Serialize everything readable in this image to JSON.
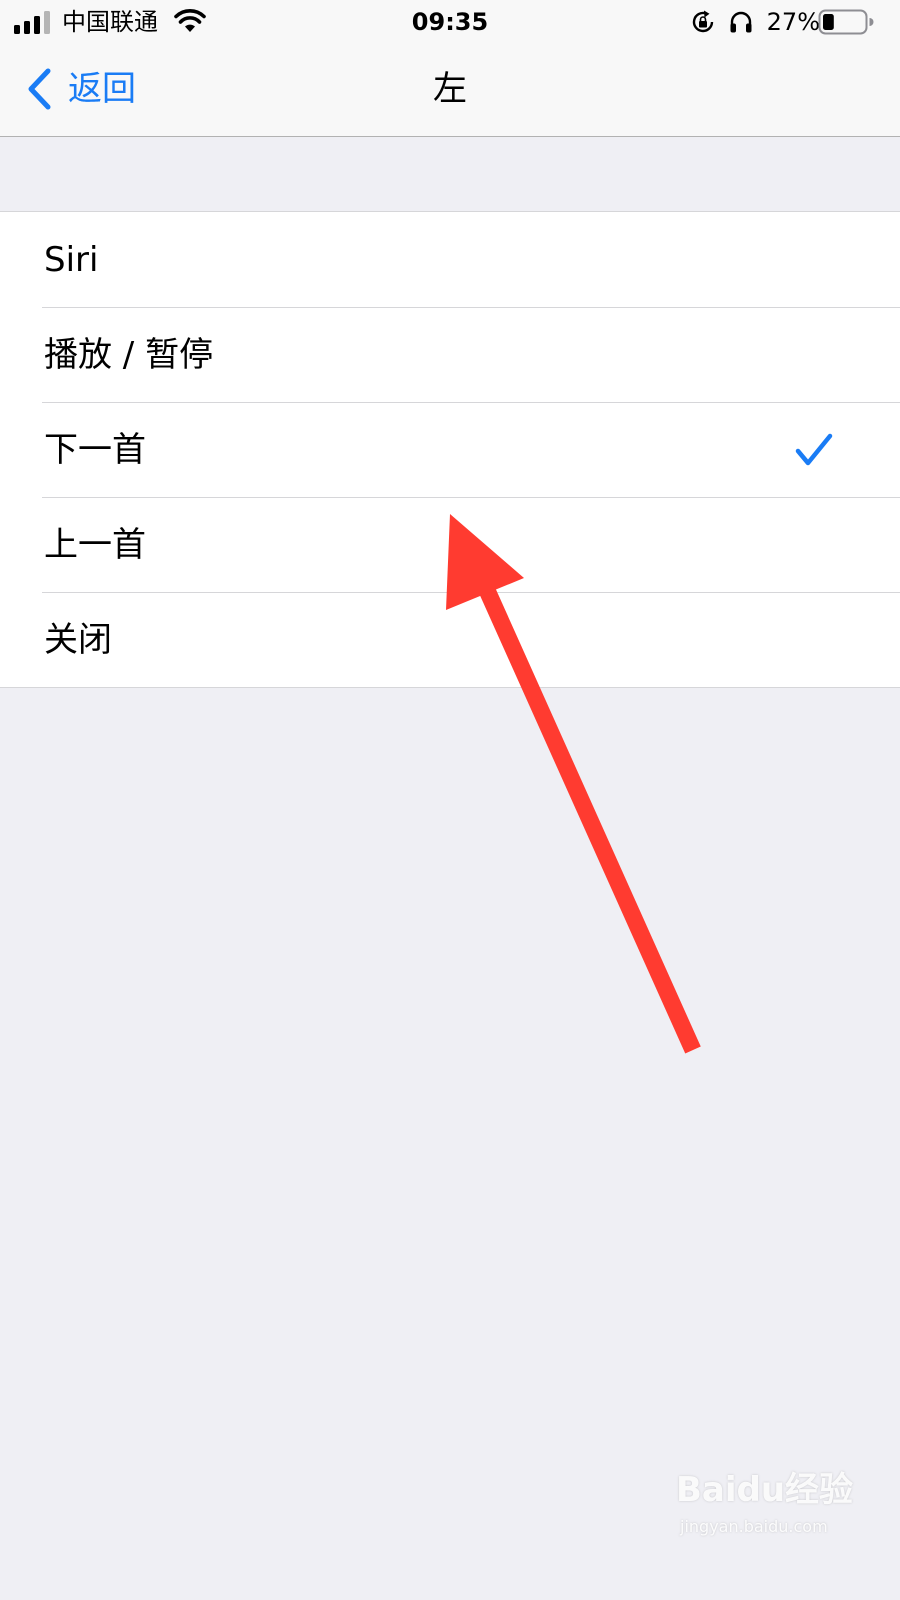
{
  "status_bar": {
    "carrier": "中国联通",
    "time": "09:35",
    "battery_percent": "27%",
    "battery_level": 0.27,
    "icons": [
      "signal-icon",
      "wifi-icon",
      "rotation-lock-icon",
      "headphones-icon",
      "battery-icon"
    ]
  },
  "nav": {
    "back_label": "返回",
    "title": "左",
    "accent_color": "#1a7cf5"
  },
  "options": [
    {
      "label": "Siri",
      "selected": false
    },
    {
      "label": "播放 / 暂停",
      "selected": false
    },
    {
      "label": "下一首",
      "selected": true
    },
    {
      "label": "上一首",
      "selected": false
    },
    {
      "label": "关闭",
      "selected": false
    }
  ],
  "annotation": {
    "arrow_color": "#ff3b30"
  },
  "watermark": {
    "brand": "Baidu经验",
    "url": "jingyan.baidu.com"
  }
}
